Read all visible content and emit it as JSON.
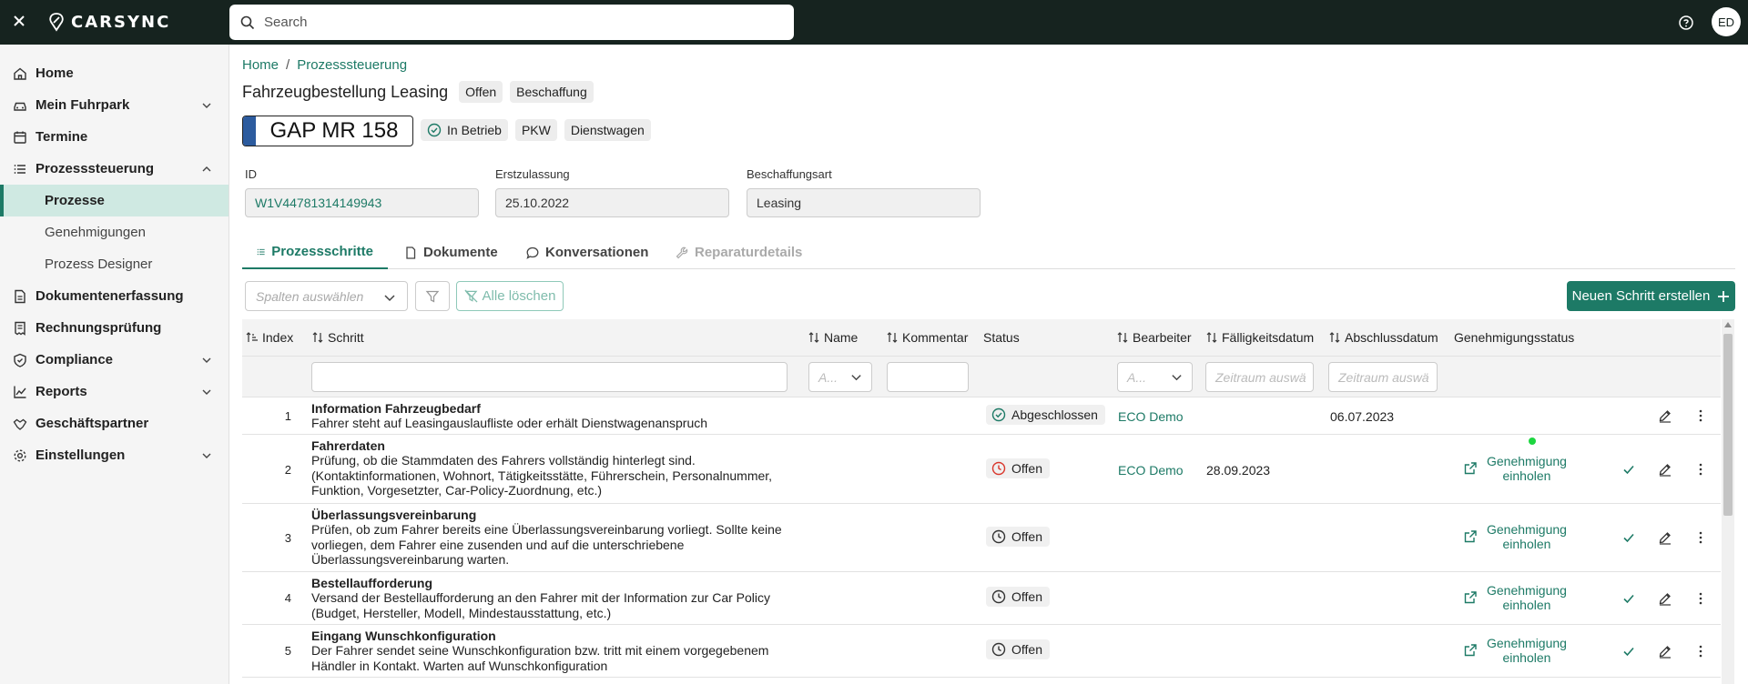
{
  "topbar": {
    "brand": "CARSYNC",
    "search_placeholder": "Search",
    "avatar_initials": "ED"
  },
  "sidebar": {
    "items": [
      {
        "label": "Home",
        "icon": "home-icon",
        "expandable": false
      },
      {
        "label": "Mein Fuhrpark",
        "icon": "car-icon",
        "expandable": true
      },
      {
        "label": "Termine",
        "icon": "calendar-icon",
        "expandable": false
      },
      {
        "label": "Prozesssteuerung",
        "icon": "list-icon",
        "expandable": true,
        "expanded": true
      },
      {
        "label": "Dokumentenerfassung",
        "icon": "document-icon",
        "expandable": false
      },
      {
        "label": "Rechnungsprüfung",
        "icon": "receipt-icon",
        "expandable": false
      },
      {
        "label": "Compliance",
        "icon": "shield-icon",
        "expandable": true
      },
      {
        "label": "Reports",
        "icon": "chart-icon",
        "expandable": true
      },
      {
        "label": "Geschäftspartner",
        "icon": "handshake-icon",
        "expandable": false
      },
      {
        "label": "Einstellungen",
        "icon": "gear-icon",
        "expandable": true
      }
    ],
    "subitems": [
      {
        "label": "Prozesse",
        "active": true
      },
      {
        "label": "Genehmigungen",
        "active": false
      },
      {
        "label": "Prozess Designer",
        "active": false
      }
    ]
  },
  "breadcrumb": {
    "home": "Home",
    "separator": "/",
    "current": "Prozesssteuerung"
  },
  "page": {
    "title": "Fahrzeugbestellung Leasing",
    "chips": [
      "Offen",
      "Beschaffung"
    ]
  },
  "vehicle": {
    "plate": "GAP MR 158",
    "status": "In Betrieb",
    "chips": [
      "PKW",
      "Dienstwagen"
    ]
  },
  "fields": {
    "id_label": "ID",
    "id_value": "W1V44781314149943",
    "ez_label": "Erstzulassung",
    "ez_value": "25.10.2022",
    "ba_label": "Beschaffungsart",
    "ba_value": "Leasing"
  },
  "tabs": [
    {
      "label": "Prozessschritte",
      "icon": "list-icon",
      "active": true
    },
    {
      "label": "Dokumente",
      "icon": "document-icon",
      "active": false
    },
    {
      "label": "Konversationen",
      "icon": "chat-icon",
      "active": false
    },
    {
      "label": "Reparaturdetails",
      "icon": "wrench-icon",
      "active": false,
      "disabled": true
    }
  ],
  "toolbar": {
    "columns_placeholder": "Spalten auswählen",
    "clear_label": "Alle löschen",
    "new_step_label": "Neuen Schritt erstellen"
  },
  "table": {
    "headers": {
      "index": "Index",
      "step": "Schritt",
      "name": "Name",
      "comment": "Kommentar",
      "status": "Status",
      "assignee": "Bearbeiter",
      "due": "Fälligkeitsdatum",
      "closed": "Abschlussdatum",
      "approval": "Genehmigungsstatus"
    },
    "filters": {
      "name_placeholder": "A...",
      "assignee_placeholder": "A...",
      "due_placeholder": "Zeitraum auswä",
      "closed_placeholder": "Zeitraum auswä"
    },
    "rows": [
      {
        "index": "1",
        "title": "Information Fahrzeugbedarf",
        "desc": [
          "Fahrer steht auf Leasingauslaufliste oder erhält Dienstwagenanspruch"
        ],
        "status": "Abgeschlossen",
        "status_kind": "done",
        "assignee": "ECO Demo",
        "due": "",
        "closed": "06.07.2023",
        "approval": ""
      },
      {
        "index": "2",
        "title": "Fahrerdaten",
        "desc": [
          "Prüfung, ob die Stammdaten des Fahrers vollständig hinterlegt sind.",
          "(Kontaktinformationen, Wohnort, Tätigkeitsstätte, Führerschein, Personalnummer,",
          "Funktion, Vorgesetzter, Car-Policy-Zuordnung, etc.)"
        ],
        "status": "Offen",
        "status_kind": "overdue",
        "assignee": "ECO Demo",
        "due": "28.09.2023",
        "closed": "",
        "approval": [
          "Genehmigung",
          "einholen"
        ]
      },
      {
        "index": "3",
        "title": "Überlassungsvereinbarung",
        "desc": [
          "Prüfen, ob zum Fahrer bereits eine Überlassungsvereinbarung vorliegt. Sollte keine",
          "vorliegen, dem Fahrer eine zusenden und auf die unterschriebene",
          "Überlassungsvereinbarung warten."
        ],
        "status": "Offen",
        "status_kind": "open",
        "assignee": "",
        "due": "",
        "closed": "",
        "approval": [
          "Genehmigung",
          "einholen"
        ]
      },
      {
        "index": "4",
        "title": "Bestellaufforderung",
        "desc": [
          "Versand der Bestellaufforderung an den Fahrer mit der Information zur Car Policy",
          "(Budget, Hersteller, Modell, Mindestausstattung, etc.)"
        ],
        "status": "Offen",
        "status_kind": "open",
        "assignee": "",
        "due": "",
        "closed": "",
        "approval": [
          "Genehmigung",
          "einholen"
        ]
      },
      {
        "index": "5",
        "title": "Eingang Wunschkonfiguration",
        "desc": [
          "Der Fahrer sendet seine Wunschkonfiguration bzw. tritt mit einem vorgegebenem",
          "Händler in Kontakt. Warten auf Wunschkonfiguration"
        ],
        "status": "Offen",
        "status_kind": "open",
        "assignee": "",
        "due": "",
        "closed": "",
        "approval": [
          "Genehmigung",
          "einholen"
        ]
      }
    ]
  },
  "colors": {
    "topbar": "#16231f",
    "accent": "#1d7a66",
    "active_nav_bg": "#cfe9e2",
    "overdue_red": "#d9362b",
    "plate_blue": "#2c5b9e"
  }
}
